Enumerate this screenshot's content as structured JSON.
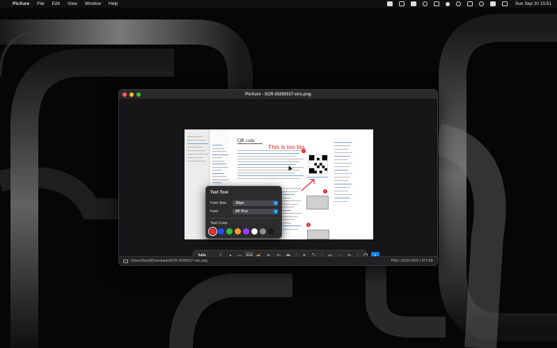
{
  "menubar": {
    "app_name": "PicXure",
    "menus": [
      "File",
      "Edit",
      "View",
      "Window",
      "Help"
    ],
    "clock": "Sun Sep 20  15:51"
  },
  "window": {
    "title": "PicXure - SCR-20260317-oirc.png",
    "status_path": "/Users/David/Downloads/SCR-20260317-oirc.png",
    "status_info": "PNG | 3032×1837 | 973 KB"
  },
  "document": {
    "heading": "QR code",
    "annotation_text": "This is too big",
    "badges": [
      "1",
      "2",
      "3"
    ]
  },
  "toolbar": {
    "zoom": "34%",
    "tools": [
      {
        "name": "pen-tool-icon",
        "glyph": "╱",
        "state": "normal"
      },
      {
        "name": "arrow-tool-icon",
        "glyph": "↗",
        "state": "normal"
      },
      {
        "name": "rectangle-tool-icon",
        "glyph": "▭",
        "state": "normal"
      },
      {
        "name": "text-tool-icon",
        "glyph": "Aa",
        "state": "active"
      },
      {
        "name": "signature-tool-icon",
        "glyph": "✍",
        "state": "normal"
      },
      {
        "name": "highlighter-tool-icon",
        "glyph": "✎",
        "state": "normal"
      },
      {
        "name": "counter-tool-icon",
        "glyph": "①",
        "state": "normal"
      },
      {
        "name": "redact-tool-icon",
        "glyph": "▦",
        "state": "normal"
      },
      {
        "name": "sep",
        "glyph": "",
        "state": "sep"
      },
      {
        "name": "crop-tool-icon",
        "glyph": "⌗",
        "state": "normal"
      },
      {
        "name": "resize-tool-icon",
        "glyph": "⤡",
        "state": "normal"
      },
      {
        "name": "sep",
        "glyph": "",
        "state": "sep"
      },
      {
        "name": "undo-icon",
        "glyph": "↶",
        "state": "normal"
      },
      {
        "name": "redo-icon",
        "glyph": "↷",
        "state": "dim"
      },
      {
        "name": "reset-icon",
        "glyph": "↻",
        "state": "normal"
      },
      {
        "name": "sep",
        "glyph": "",
        "state": "sep"
      },
      {
        "name": "copy-icon",
        "glyph": "❐",
        "state": "normal"
      },
      {
        "name": "share-icon",
        "glyph": "⇪",
        "state": "primary"
      }
    ]
  },
  "text_tool": {
    "title": "Text Tool",
    "font_size_label": "Font Size",
    "font_size_value": "16px",
    "font_label": "Font",
    "font_value": "SF Pro",
    "text_color_label": "Text Color",
    "colors": [
      "#ff2d2d",
      "#1e4dff",
      "#2fc43a",
      "#ff9a2e",
      "#9b3cff",
      "#ffffff",
      "#8e8e93",
      "#1a1a1a"
    ],
    "selected_color": "#ff2d2d"
  }
}
